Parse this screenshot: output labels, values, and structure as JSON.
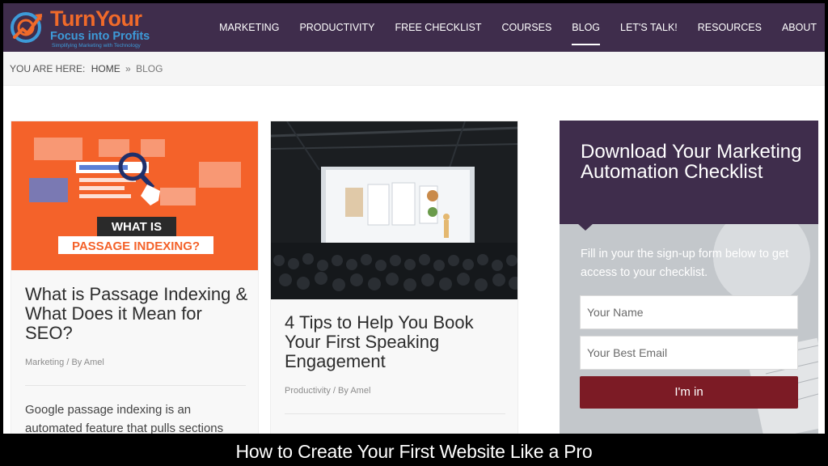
{
  "header": {
    "logo_title": "TurnYour",
    "logo_subtitle": "Focus into Profits",
    "logo_tagline": "Simplifying Marketing with Technology",
    "brand_colors": {
      "header_bg": "#3f2d4c",
      "logo_orange": "#f06a2a",
      "logo_blue": "#3d9ad8"
    },
    "nav": [
      {
        "label": "MARKETING",
        "active": false
      },
      {
        "label": "PRODUCTIVITY",
        "active": false
      },
      {
        "label": "FREE CHECKLIST",
        "active": false
      },
      {
        "label": "COURSES",
        "active": false
      },
      {
        "label": "BLOG",
        "active": true
      },
      {
        "label": "LET'S TALK!",
        "active": false
      },
      {
        "label": "RESOURCES",
        "active": false
      },
      {
        "label": "ABOUT",
        "active": false
      }
    ]
  },
  "breadcrumb": {
    "prefix": "YOU ARE HERE:",
    "home": "HOME",
    "separator": "»",
    "current": "BLOG"
  },
  "posts": [
    {
      "thumb_line1": "WHAT IS",
      "thumb_line2": "PASSAGE INDEXING?",
      "title": "What is Passage Indexing & What Does it Mean for SEO?",
      "category": "Marketing",
      "author": "/ By Amel",
      "excerpt": "Google passage indexing is an automated feature that pulls sections"
    },
    {
      "title": "4 Tips to Help You Book Your First Speaking Engagement",
      "category": "Productivity",
      "author": "/ By Amel"
    }
  ],
  "optin": {
    "title": "Download Your Marketing Automation Checklist",
    "description": "Fill in your the sign-up form below to get access to your checklist.",
    "name_placeholder": "Your Name",
    "email_placeholder": "Your Best Email",
    "submit_label": "I'm in",
    "button_color": "#7c1b25"
  },
  "caption": "How to Create Your First Website Like a Pro"
}
